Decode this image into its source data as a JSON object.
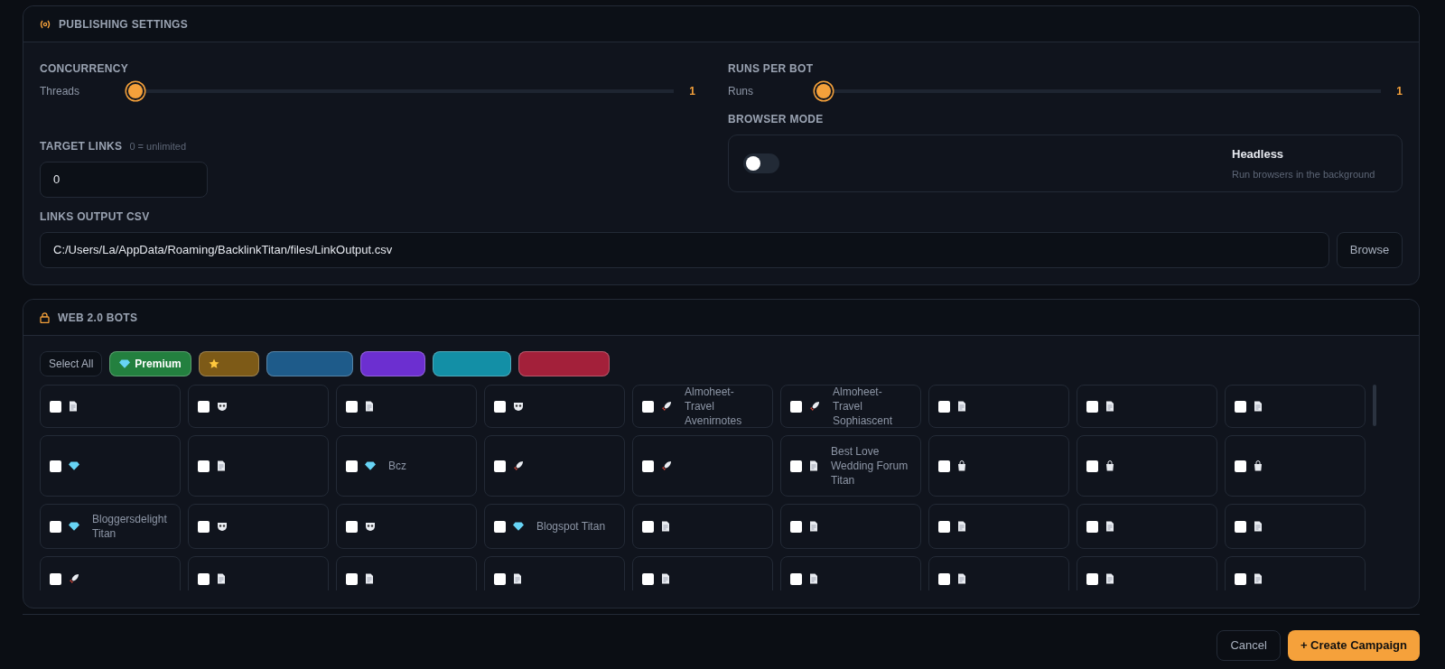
{
  "publishing": {
    "title": "PUBLISHING SETTINGS",
    "concurrency": {
      "label": "CONCURRENCY",
      "sub": "Threads",
      "level": 0,
      "value": "1"
    },
    "runs": {
      "label": "RUNS PER BOT",
      "sub": "Runs",
      "level": 0,
      "value": "1"
    },
    "target": {
      "label": "TARGET LINKS",
      "hint": "0 = unlimited",
      "value": "0"
    },
    "browser": {
      "label": "BROWSER MODE",
      "on": false,
      "title": "Headless",
      "desc": "Run browsers in the background"
    },
    "output": {
      "label": "LINKS OUTPUT CSV",
      "value": "C:/Users/La/AppData/Roaming/BacklinkTitan/files/LinkOutput.csv",
      "button": "Browse"
    }
  },
  "bots": {
    "title": "WEB 2.0 BOTS",
    "select_all": "Select All",
    "filters": [
      {
        "label": "Premium",
        "color": "#23803f",
        "kind": "gem"
      },
      {
        "color": "#7d5a17",
        "kind": "star"
      },
      {
        "color": "#1e5b8a",
        "kind": "plain"
      },
      {
        "color": "#6c2fd0",
        "kind": "plain"
      },
      {
        "color": "#138fa6",
        "kind": "plain"
      },
      {
        "color": "#a3203a",
        "kind": "plain"
      }
    ],
    "items": [
      {
        "kind": "article",
        "checked": false
      },
      {
        "kind": "mask",
        "checked": false
      },
      {
        "kind": "article",
        "checked": false
      },
      {
        "kind": "mask",
        "checked": false
      },
      {
        "kind": "rocket",
        "checked": false,
        "name": "Almoheet-Travel Avenirnotes"
      },
      {
        "kind": "rocket",
        "checked": false,
        "name": "Almoheet-Travel Sophiascent"
      },
      {
        "kind": "article",
        "checked": false
      },
      {
        "kind": "article",
        "checked": false
      },
      {
        "kind": "article",
        "checked": false
      },
      {
        "kind": "premium",
        "checked": false
      },
      {
        "kind": "article",
        "checked": false
      },
      {
        "kind": "premium",
        "checked": false,
        "name": "Bcz"
      },
      {
        "kind": "rocket",
        "checked": false
      },
      {
        "kind": "rocket",
        "checked": false
      },
      {
        "kind": "article",
        "checked": false,
        "name": "Best Love Wedding Forum Titan"
      },
      {
        "kind": "bag",
        "checked": false
      },
      {
        "kind": "bag",
        "checked": false
      },
      {
        "kind": "bag",
        "checked": false
      },
      {
        "kind": "premium",
        "checked": false,
        "name": "Bloggersdelight Titan"
      },
      {
        "kind": "mask",
        "checked": false
      },
      {
        "kind": "mask",
        "checked": false
      },
      {
        "kind": "premium",
        "checked": false,
        "name": "Blogspot Titan"
      },
      {
        "kind": "article",
        "checked": false
      },
      {
        "kind": "article",
        "checked": false
      },
      {
        "kind": "article",
        "checked": false
      },
      {
        "kind": "article",
        "checked": false
      },
      {
        "kind": "article",
        "checked": false
      },
      {
        "kind": "rocket",
        "checked": false
      },
      {
        "kind": "article",
        "checked": false
      },
      {
        "kind": "article",
        "checked": false
      },
      {
        "kind": "article",
        "checked": false
      },
      {
        "kind": "article",
        "checked": false
      },
      {
        "kind": "article",
        "checked": false
      },
      {
        "kind": "article",
        "checked": false
      },
      {
        "kind": "article",
        "checked": false
      },
      {
        "kind": "article",
        "checked": false
      }
    ]
  },
  "footer": {
    "cancel": "Cancel",
    "create": "+ Create Campaign"
  }
}
